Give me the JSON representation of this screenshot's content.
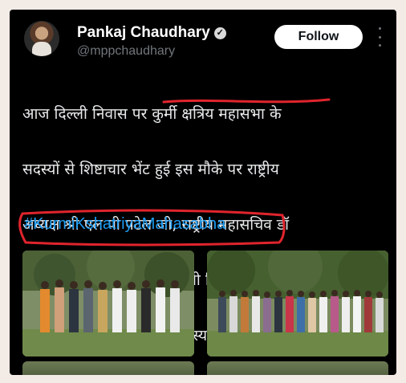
{
  "header": {
    "name": "Pankaj Chaudhary",
    "handle": "@mppchaudhary",
    "follow_label": "Follow"
  },
  "tweet": {
    "lines": [
      "आज दिल्ली निवास पर कुर्मी क्षत्रिय महासभा के",
      "सदस्यों से शिष्टाचार भेंट हुई इस मौके पर राष्ट्रीय",
      "अध्यक्ष श्री एल पी पटेल जी, राष्ट्रीय महासचिव डॉ",
      "वी ऐस  निरंजन जी,दुर्ग सांसद श्री विजय बघेल जी",
      "छत्तीसगढ़ व अन्य गणमान्य सदस्यगण उपस्थित रहे ।"
    ],
    "hashtag": "#KurmiKshatriyaMahasabha"
  },
  "colors": {
    "background": "#000000",
    "text": "#e7e9ea",
    "hashtag": "#1d9bf0",
    "annotation": "#e0242d",
    "secondary": "#71767b"
  },
  "icons": {
    "verified": "verified-badge-icon",
    "more": "more-vertical-icon"
  }
}
